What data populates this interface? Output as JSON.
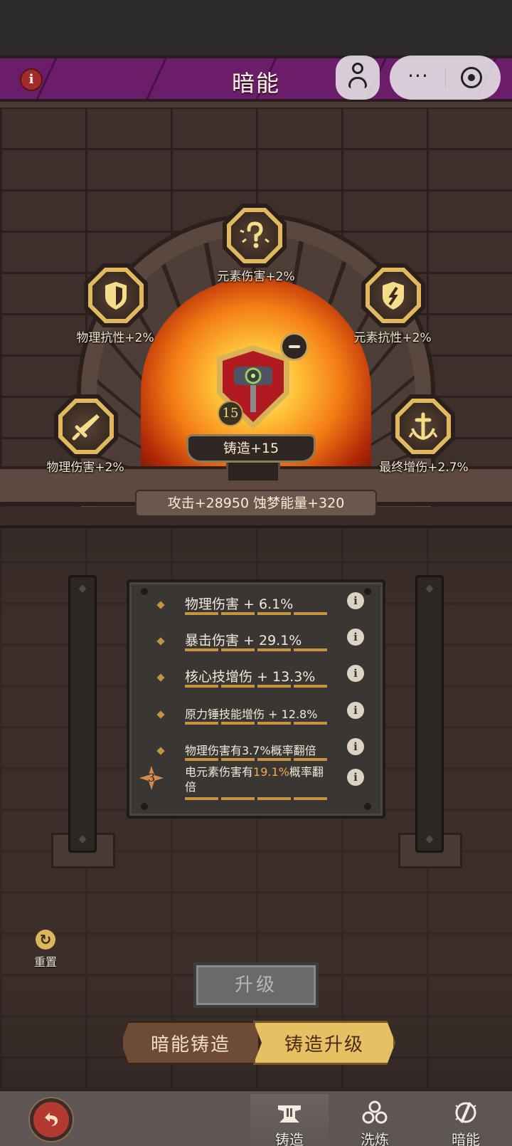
{
  "header": {
    "title": "暗能",
    "info_icon": "info-icon",
    "menu_dots": "···"
  },
  "forge": {
    "nodes": [
      {
        "icon": "question-mark-icon",
        "label": "元素伤害+2%"
      },
      {
        "icon": "shield-icon",
        "label": "物理抗性+2%"
      },
      {
        "icon": "element-shield-icon",
        "label": "元素抗性+2%"
      },
      {
        "icon": "sword-icon",
        "label": "物理伤害+2%"
      },
      {
        "icon": "anchor-burst-icon",
        "label": "最终增伤+2.7%"
      }
    ],
    "weapon_level": "15",
    "anvil_label": "铸造+15",
    "stats_summary": "攻击+28950  蚀梦能量+320"
  },
  "attributes": [
    {
      "text": "物理伤害 + 6.1%"
    },
    {
      "text": "暴击伤害 + 29.1%"
    },
    {
      "text": "核心技增伤 + 13.3%"
    },
    {
      "text": "原力锤技能增伤 + 12.8%"
    },
    {
      "text": "物理伤害有3.7%概率翻倍"
    },
    {
      "text_prefix": "电元素伤害有",
      "text_highlight": "19.1%",
      "text_suffix": "概率翻倍",
      "tier": "3"
    }
  ],
  "actions": {
    "reset_label": "重置",
    "upgrade_label": "升级"
  },
  "mode_tabs": {
    "left": "暗能铸造",
    "right": "铸造升级",
    "selected": "right"
  },
  "nav": {
    "tabs": [
      {
        "label": "铸造",
        "icon": "anvil-icon",
        "active": true
      },
      {
        "label": "洗炼",
        "icon": "triple-circle-icon",
        "active": false
      },
      {
        "label": "暗能",
        "icon": "dark-energy-icon",
        "active": false
      }
    ]
  },
  "colors": {
    "title_bar": "#6b1d6a",
    "highlight": "#f5a94a",
    "gold": "#e8c064",
    "bar": "#c8933d"
  }
}
